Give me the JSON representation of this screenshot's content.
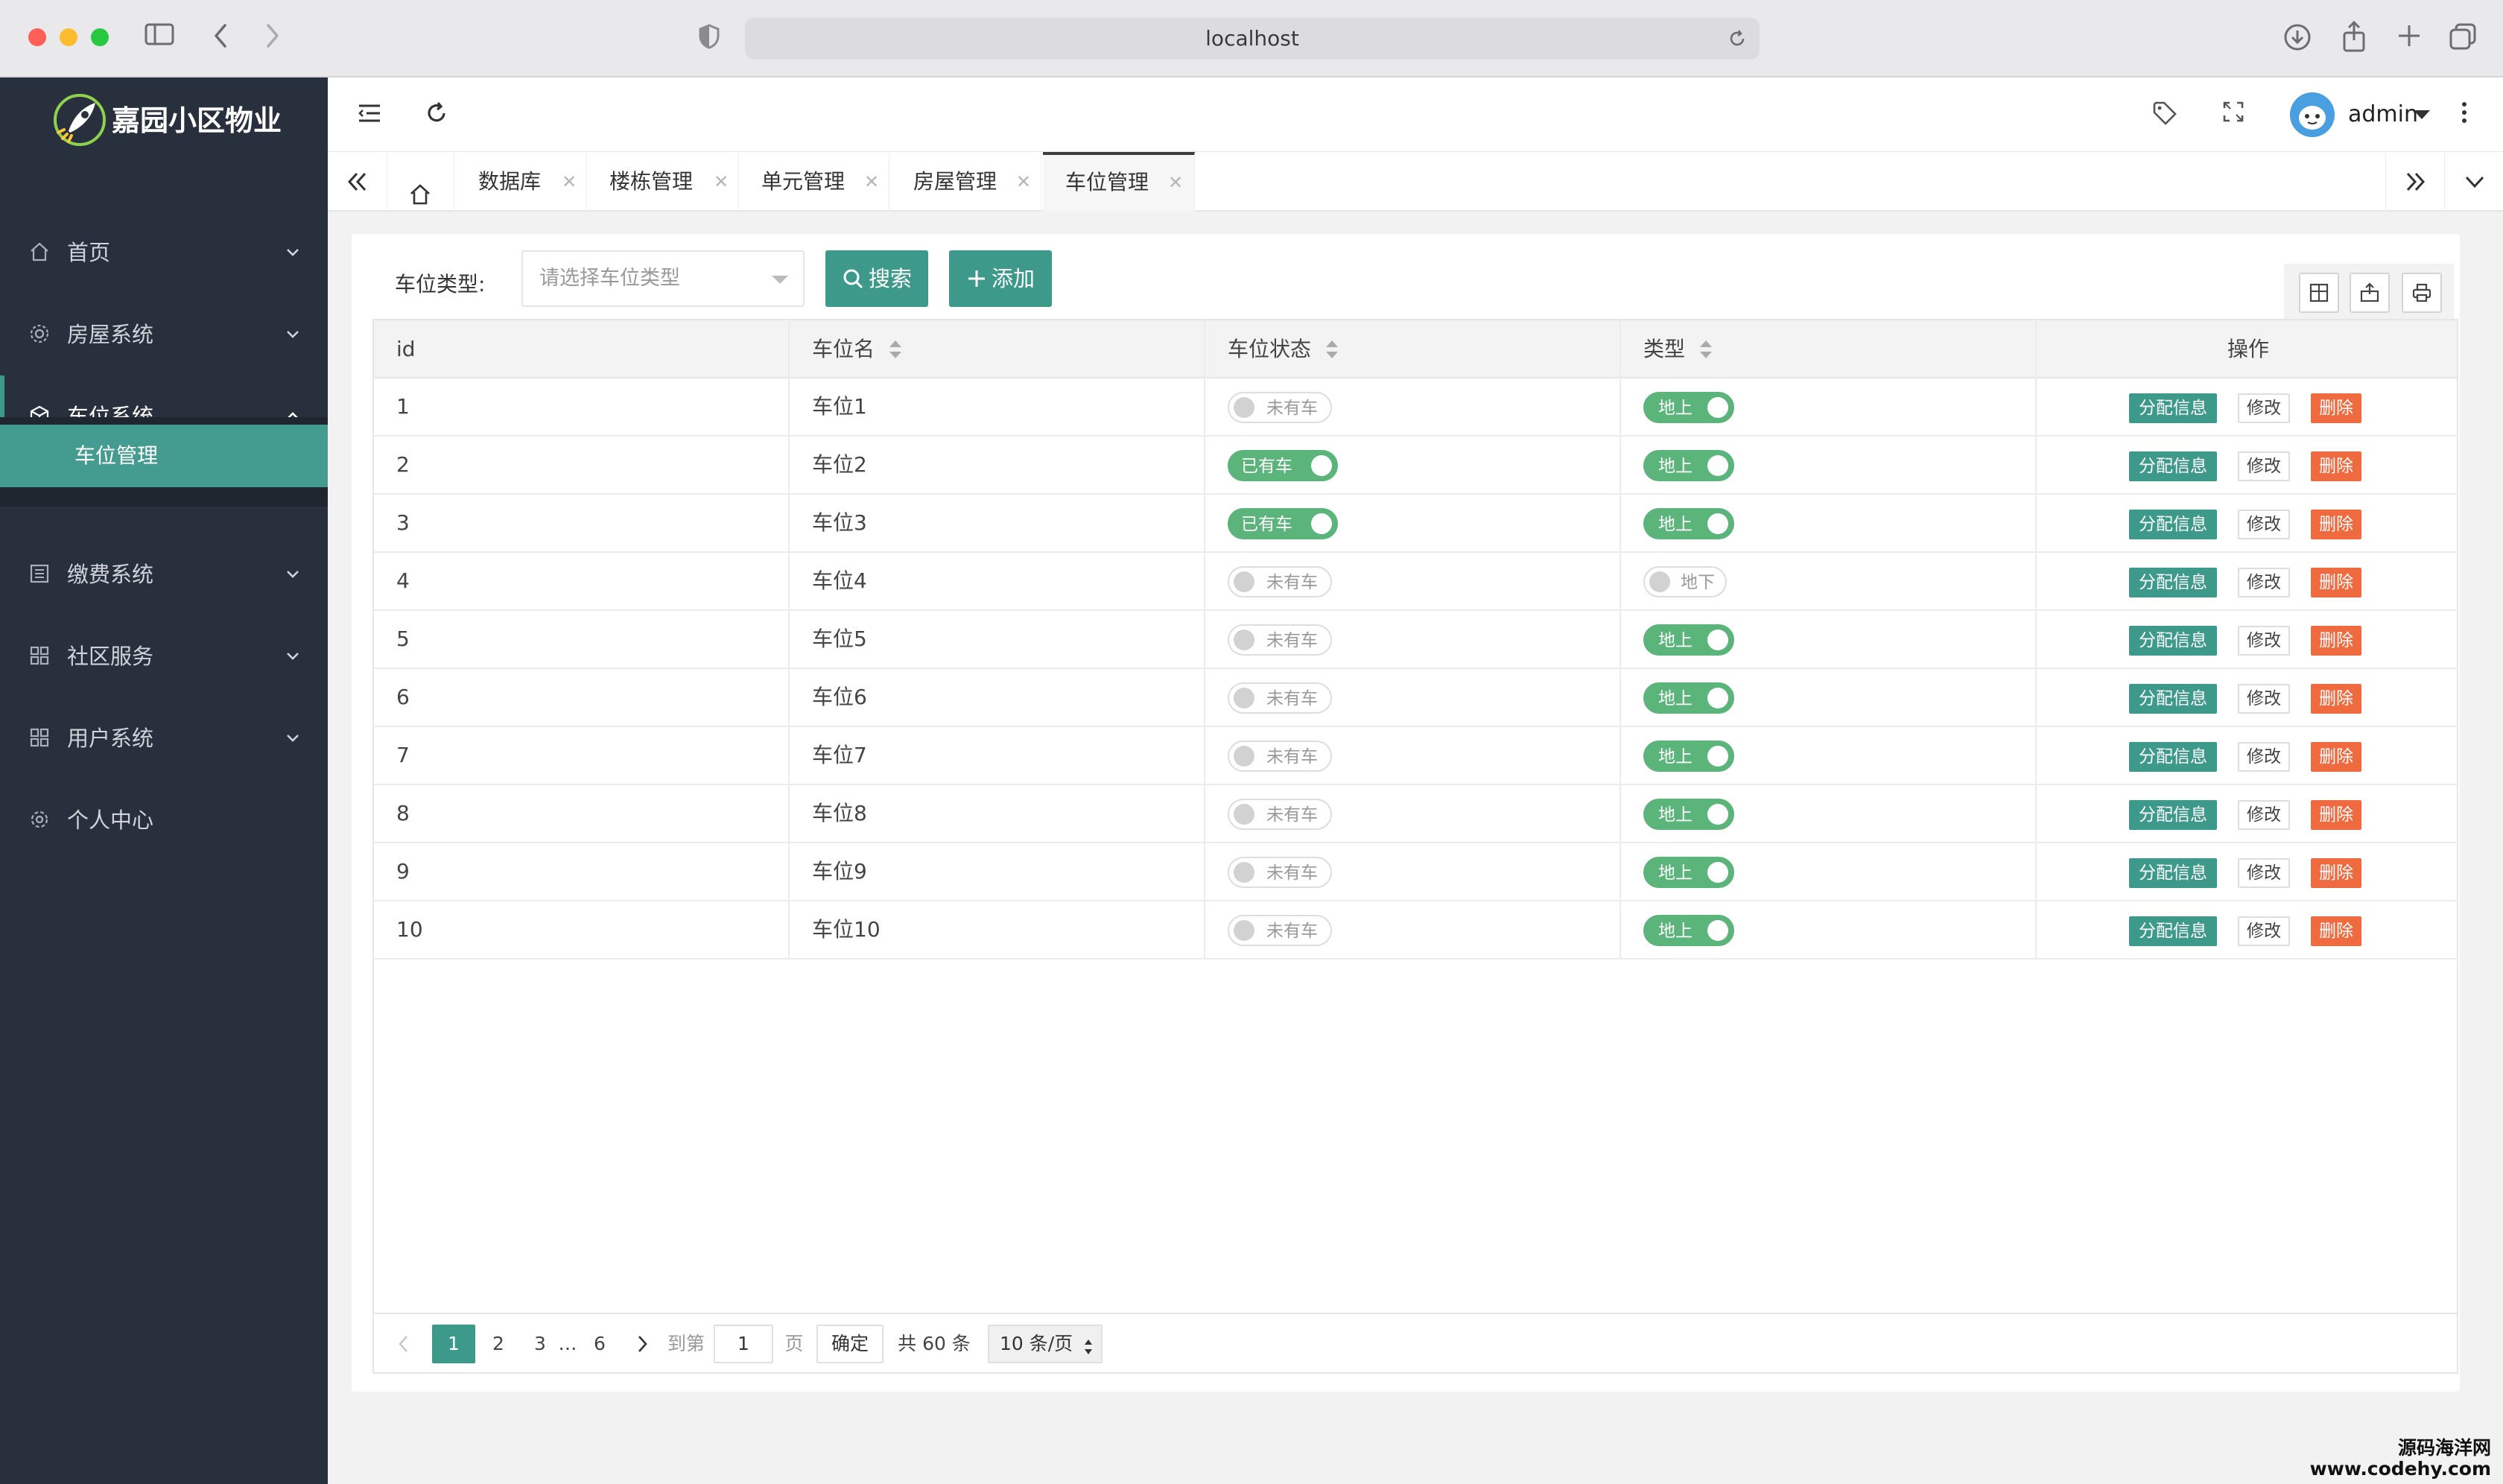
{
  "browser": {
    "url": "localhost"
  },
  "sidebar": {
    "brand": "嘉园小区物业",
    "items": [
      {
        "label": "首页",
        "icon": "home-icon"
      },
      {
        "label": "房屋系统",
        "icon": "gear-icon"
      },
      {
        "label": "车位系统",
        "icon": "cube-icon"
      },
      {
        "label": "缴费系统",
        "icon": "list-icon"
      },
      {
        "label": "社区服务",
        "icon": "apps-icon"
      },
      {
        "label": "用户系统",
        "icon": "apps-icon"
      },
      {
        "label": "个人中心",
        "icon": "settings-icon"
      }
    ],
    "active_sub": "车位管理"
  },
  "header": {
    "user": "admin"
  },
  "tabs": [
    "数据库",
    "楼栋管理",
    "单元管理",
    "房屋管理",
    "车位管理"
  ],
  "toolbar": {
    "filter_label": "车位类型:",
    "filter_placeholder": "请选择车位类型",
    "search_label": "搜索",
    "add_label": "添加"
  },
  "table": {
    "columns": [
      "id",
      "车位名",
      "车位状态",
      "类型",
      "操作"
    ],
    "rows": [
      {
        "id": "1",
        "name": "车位1",
        "status": "未有车",
        "status_on": false,
        "type": "地上",
        "type_on": true
      },
      {
        "id": "2",
        "name": "车位2",
        "status": "已有车",
        "status_on": true,
        "type": "地上",
        "type_on": true
      },
      {
        "id": "3",
        "name": "车位3",
        "status": "已有车",
        "status_on": true,
        "type": "地上",
        "type_on": true
      },
      {
        "id": "4",
        "name": "车位4",
        "status": "未有车",
        "status_on": false,
        "type": "地下",
        "type_on": false
      },
      {
        "id": "5",
        "name": "车位5",
        "status": "未有车",
        "status_on": false,
        "type": "地上",
        "type_on": true
      },
      {
        "id": "6",
        "name": "车位6",
        "status": "未有车",
        "status_on": false,
        "type": "地上",
        "type_on": true
      },
      {
        "id": "7",
        "name": "车位7",
        "status": "未有车",
        "status_on": false,
        "type": "地上",
        "type_on": true
      },
      {
        "id": "8",
        "name": "车位8",
        "status": "未有车",
        "status_on": false,
        "type": "地上",
        "type_on": true
      },
      {
        "id": "9",
        "name": "车位9",
        "status": "未有车",
        "status_on": false,
        "type": "地上",
        "type_on": true
      },
      {
        "id": "10",
        "name": "车位10",
        "status": "未有车",
        "status_on": false,
        "type": "地上",
        "type_on": true
      }
    ],
    "actions": {
      "assign": "分配信息",
      "edit": "修改",
      "delete": "删除"
    }
  },
  "pagination": {
    "pages": [
      "1",
      "2",
      "3",
      "…",
      "6"
    ],
    "current": "1",
    "goto_label": "到第",
    "goto_value": "1",
    "page_unit": "页",
    "confirm": "确定",
    "total": "共 60 条",
    "page_size": "10 条/页"
  },
  "watermark": {
    "line1": "源码海洋网",
    "line2": "www.codehy.com"
  },
  "colors": {
    "accent": "#3d9a8b",
    "sidebar_bg": "#28303d",
    "switch_on": "#5bb47a",
    "danger": "#f06a40"
  }
}
